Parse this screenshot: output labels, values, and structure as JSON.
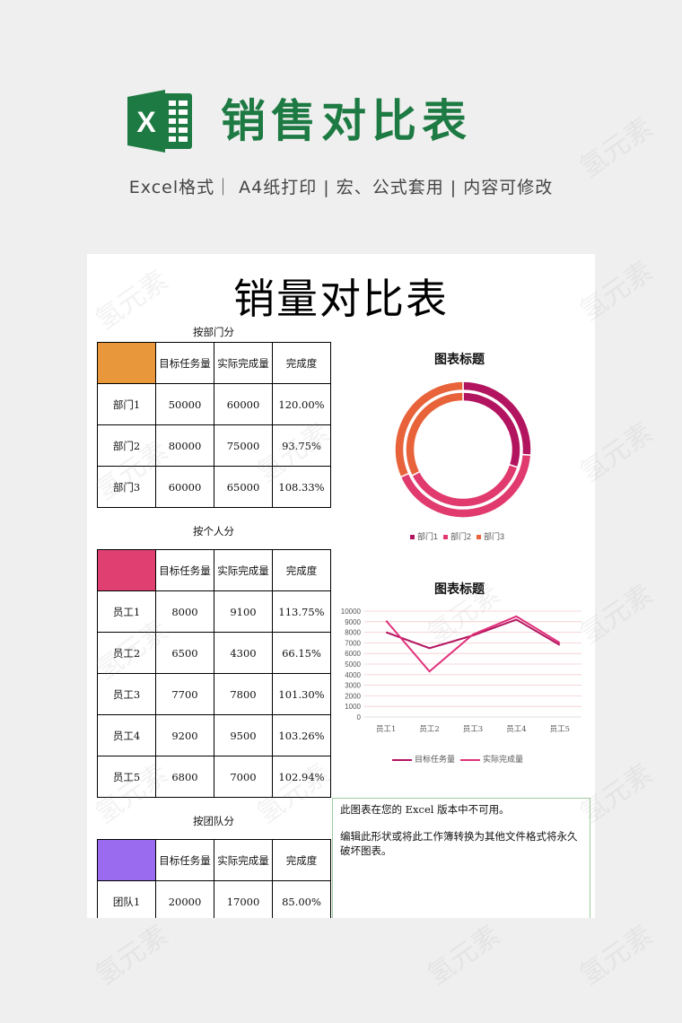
{
  "header": {
    "title": "销售对比表",
    "subtitle": "Excel格式｜ A4纸打印 | 宏、公式套用 | 内容可修改",
    "logo_letter": "X"
  },
  "sheet": {
    "title": "销量对比表",
    "columns": [
      "目标任务量",
      "实际完成量",
      "完成度"
    ],
    "dept": {
      "label": "按部门分",
      "color": "#e9973b",
      "rows": [
        {
          "name": "部门1",
          "target": "50000",
          "actual": "60000",
          "rate": "120.00%"
        },
        {
          "name": "部门2",
          "target": "80000",
          "actual": "75000",
          "rate": "93.75%"
        },
        {
          "name": "部门3",
          "target": "60000",
          "actual": "65000",
          "rate": "108.33%"
        }
      ]
    },
    "person": {
      "label": "按个人分",
      "color": "#e03f72",
      "rows": [
        {
          "name": "员工1",
          "target": "8000",
          "actual": "9100",
          "rate": "113.75%"
        },
        {
          "name": "员工2",
          "target": "6500",
          "actual": "4300",
          "rate": "66.15%"
        },
        {
          "name": "员工3",
          "target": "7700",
          "actual": "7800",
          "rate": "101.30%"
        },
        {
          "name": "员工4",
          "target": "9200",
          "actual": "9500",
          "rate": "103.26%"
        },
        {
          "name": "员工5",
          "target": "6800",
          "actual": "7000",
          "rate": "102.94%"
        }
      ]
    },
    "team": {
      "label": "按团队分",
      "color": "#9b6bef",
      "rows": [
        {
          "name": "团队1",
          "target": "20000",
          "actual": "17000",
          "rate": "85.00%"
        }
      ]
    },
    "notice": {
      "line1": "此图表在您的 Excel 版本中不可用。",
      "line2": "编辑此形状或将此工作簿转换为其他文件格式将永久破坏图表。"
    }
  },
  "chart_data": [
    {
      "type": "pie",
      "title": "图表标题",
      "categories": [
        "部门1",
        "部门2",
        "部门3"
      ],
      "series": [
        {
          "name": "目标任务量",
          "values": [
            50000,
            80000,
            60000
          ]
        },
        {
          "name": "实际完成量",
          "values": [
            60000,
            75000,
            65000
          ]
        }
      ],
      "colors": [
        "#b3145f",
        "#e03a6e",
        "#e8623a"
      ],
      "legend": "bottom"
    },
    {
      "type": "line",
      "title": "图表标题",
      "categories": [
        "员工1",
        "员工2",
        "员工3",
        "员工4",
        "员工5"
      ],
      "series": [
        {
          "name": "目标任务量",
          "values": [
            8000,
            6500,
            7700,
            9200,
            6800
          ],
          "color": "#b3145f"
        },
        {
          "name": "实际完成量",
          "values": [
            9100,
            4300,
            7800,
            9500,
            7000
          ],
          "color": "#e0307a"
        }
      ],
      "ylim": [
        0,
        10000
      ],
      "yticks": [
        0,
        1000,
        2000,
        3000,
        4000,
        5000,
        6000,
        7000,
        8000,
        9000,
        10000
      ],
      "grid": true,
      "legend": "bottom"
    }
  ],
  "watermark": "氢元素"
}
